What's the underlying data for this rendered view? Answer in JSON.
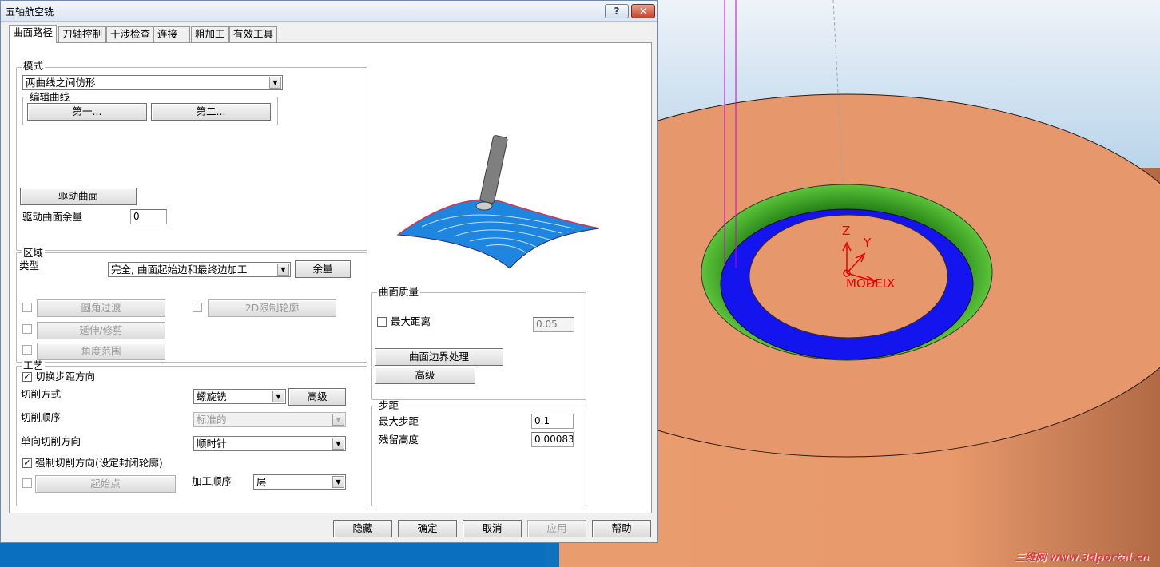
{
  "dialog": {
    "title": "五轴航空铣",
    "help_glyph": "?",
    "close_glyph": "✕"
  },
  "tabs": [
    {
      "label": "曲面路径"
    },
    {
      "label": "刀轴控制"
    },
    {
      "label": "干涉检查"
    },
    {
      "label": "连接"
    },
    {
      "label": "粗加工"
    },
    {
      "label": "有效工具"
    }
  ],
  "mode": {
    "legend": "模式",
    "value": "两曲线之间仿形",
    "edit_curves_legend": "编辑曲线",
    "first_button": "第一...",
    "second_button": "第二...",
    "drive_surface_button": "驱动曲面",
    "drive_allowance_label": "驱动曲面余量",
    "drive_allowance_value": "0"
  },
  "region": {
    "legend": "区域",
    "type_label": "类型",
    "type_value": "完全, 曲面起始边和最终边加工",
    "allowance_button": "余量",
    "fillet_button": "圆角过渡",
    "extend_trim_button": "延伸/修剪",
    "angle_range_button": "角度范围",
    "limit_2d_button": "2D限制轮廓"
  },
  "process": {
    "legend": "工艺",
    "switch_step_label": "切换步距方向",
    "switch_step_checked": true,
    "cut_method_label": "切削方式",
    "cut_method_value": "螺旋铣",
    "advanced_button": "高级",
    "cut_order_label": "切削顺序",
    "cut_order_value": "标准的",
    "one_way_label": "单向切削方向",
    "one_way_value": "顺时针",
    "force_dir_label": "强制切削方向(设定封闭轮廓)",
    "force_dir_checked": true,
    "start_point_button": "起始点",
    "machining_order_label": "加工顺序",
    "machining_order_value": "层"
  },
  "surface_quality": {
    "legend": "曲面质量",
    "max_distance_label": "最大距离",
    "max_distance_value": "0.05",
    "boundary_button": "曲面边界处理",
    "advanced_button": "高级"
  },
  "stepover": {
    "legend": "步距",
    "max_step_label": "最大步距",
    "max_step_value": "0.1",
    "scallop_label": "残留高度",
    "scallop_value": "0.000834"
  },
  "footer": {
    "hide": "隐藏",
    "ok": "确定",
    "cancel": "取消",
    "apply": "应用",
    "help": "帮助"
  },
  "viewport": {
    "axis_z": "Z",
    "axis_y": "Y",
    "axis_x": "X",
    "origin_label": "MODEL",
    "watermark": "三维网 www.3dportal.cn",
    "colors": {
      "background_top": "#e8f0f8",
      "background_bottom": "#3f8fc8",
      "part": "#e3956a",
      "ring_green": "#2e9a1e",
      "ring_blue": "#1010e8",
      "axis_red": "#e80000"
    }
  }
}
